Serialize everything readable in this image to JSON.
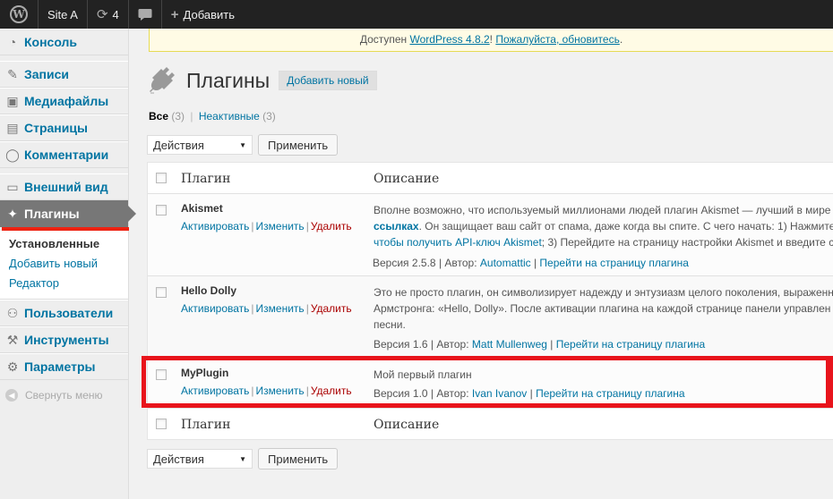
{
  "adminbar": {
    "site_name": "Site A",
    "updates_count": "4",
    "add_label": "Добавить"
  },
  "sidebar": {
    "items": [
      {
        "label": "Консоль",
        "icon": "dashboard-icon"
      },
      {
        "label": "Записи",
        "icon": "pushpin-icon"
      },
      {
        "label": "Медиафайлы",
        "icon": "media-icon"
      },
      {
        "label": "Страницы",
        "icon": "pages-icon"
      },
      {
        "label": "Комментарии",
        "icon": "comment-icon"
      },
      {
        "label": "Внешний вид",
        "icon": "appearance-icon"
      },
      {
        "label": "Плагины",
        "icon": "plugin-icon"
      },
      {
        "label": "Пользователи",
        "icon": "users-icon"
      },
      {
        "label": "Инструменты",
        "icon": "tools-icon"
      },
      {
        "label": "Параметры",
        "icon": "settings-icon"
      }
    ],
    "submenu": [
      "Установленные",
      "Добавить новый",
      "Редактор"
    ],
    "collapse_label": "Свернуть меню"
  },
  "notice": {
    "prefix": "Доступен ",
    "version_link": "WordPress 4.8.2",
    "middle": "! ",
    "update_link": "Пожалуйста, обновитесь",
    "suffix": "."
  },
  "page": {
    "title": "Плагины",
    "add_new": "Добавить новый"
  },
  "filters": {
    "all_label": "Все",
    "all_count": "(3)",
    "inactive_label": "Неактивные",
    "inactive_count": "(3)"
  },
  "bulk": {
    "select_value": "Действия",
    "apply_label": "Применить"
  },
  "table": {
    "col_plugin": "Плагин",
    "col_description": "Описание",
    "actions": {
      "activate": "Активировать",
      "edit": "Изменить",
      "delete": "Удалить"
    },
    "version_prefix": "Версия",
    "author_prefix": "Автор:",
    "plugin_page": "Перейти на страницу плагина",
    "plugins": [
      {
        "name": "Akismet",
        "desc_line1": "Вполне возможно, что используемый миллионами людей плагин Akismet — лучший в мире",
        "desc_line2_link": "ссылках",
        "desc_line2_rest": ". Он защищает ваш сайт от спама, даже когда вы спите. С чего начать: 1) Нажмите",
        "desc_line3_link": "чтобы получить API-ключ Akismet",
        "desc_line3_rest": "; 3) Перейдите на страницу настройки Akismet и введите с",
        "version": "2.5.8",
        "author": "Automattic"
      },
      {
        "name": "Hello Dolly",
        "desc_line1": "Это не просто плагин, он символизирует надежду и энтузиазм целого поколения, выраженн",
        "desc_line2": "Армстронга: «Hello, Dolly». После активации плагина на каждой странице панели управлен",
        "desc_line3": "песни.",
        "version": "1.6",
        "author": "Matt Mullenweg"
      },
      {
        "name": "MyPlugin",
        "desc_line1": "Мой первый плагин",
        "version": "1.0",
        "author": "Ivan Ivanov"
      }
    ]
  },
  "colors": {
    "admin_bar": "#222222",
    "link": "#0074a2",
    "delete": "#aa0000",
    "highlight": "#e8141c",
    "current_menu": "#777777"
  }
}
